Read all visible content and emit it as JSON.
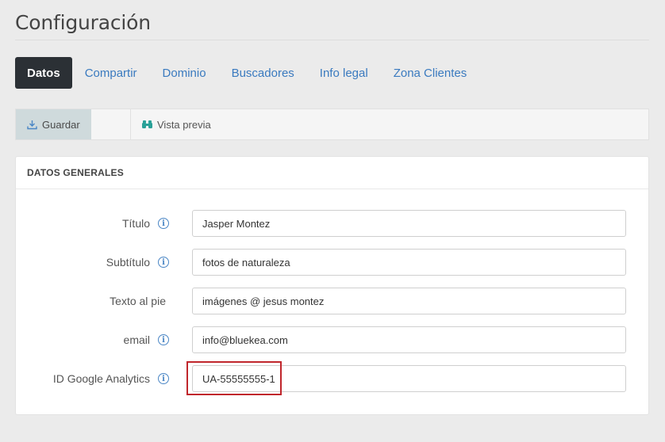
{
  "page": {
    "title": "Configuración"
  },
  "tabs": [
    {
      "label": "Datos",
      "active": true
    },
    {
      "label": "Compartir"
    },
    {
      "label": "Dominio"
    },
    {
      "label": "Buscadores"
    },
    {
      "label": "Info legal"
    },
    {
      "label": "Zona Clientes"
    }
  ],
  "toolbar": {
    "save_label": "Guardar",
    "save_icon": "download-icon",
    "preview_label": "Vista previa",
    "preview_icon": "binoculars-icon"
  },
  "panel": {
    "title": "DATOS GENERALES",
    "fields": [
      {
        "label": "Título",
        "value": "Jasper Montez",
        "info": true
      },
      {
        "label": "Subtítulo",
        "value": "fotos de naturaleza",
        "info": true
      },
      {
        "label": "Texto al pie",
        "value": "imágenes @ jesus montez",
        "info": false
      },
      {
        "label": "email",
        "value": "info@bluekea.com",
        "info": true
      },
      {
        "label": "ID Google Analytics",
        "value": "UA-55555555-1",
        "info": true,
        "highlighted": true
      }
    ]
  },
  "colors": {
    "accent": "#3a7abf",
    "active_tab": "#2b3035",
    "highlight": "#c0262c"
  }
}
